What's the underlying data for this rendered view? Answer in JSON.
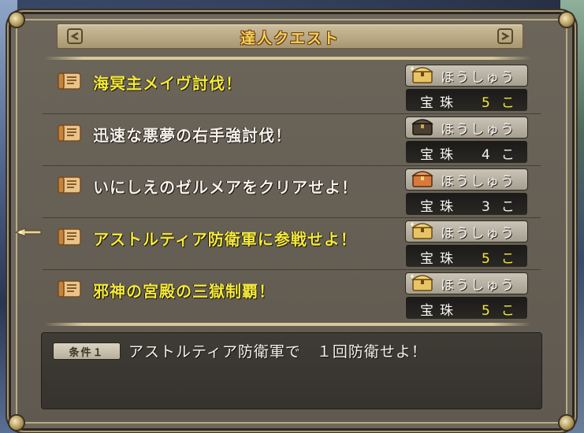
{
  "window": {
    "title": "達人クエスト"
  },
  "quests": [
    {
      "name": "海冥主メイヴ討伐！",
      "highlight": true,
      "reward": {
        "label": "ほうしゅう",
        "item": "宝珠",
        "amount": "5",
        "unit": "こ",
        "chest": "gold-chest-icon",
        "amount_highlight": true
      }
    },
    {
      "name": "迅速な悪夢の右手強討伐！",
      "highlight": false,
      "reward": {
        "label": "ほうしゅう",
        "item": "宝珠",
        "amount": "4",
        "unit": "こ",
        "chest": "dark-chest-icon",
        "amount_highlight": false
      }
    },
    {
      "name": "いにしえのゼルメアをクリアせよ！",
      "highlight": false,
      "reward": {
        "label": "ほうしゅう",
        "item": "宝珠",
        "amount": "3",
        "unit": "こ",
        "chest": "red-chest-icon",
        "amount_highlight": false
      }
    },
    {
      "name": "アストルティア防衛軍に参戦せよ！",
      "highlight": true,
      "reward": {
        "label": "ほうしゅう",
        "item": "宝珠",
        "amount": "5",
        "unit": "こ",
        "chest": "gold-chest-icon",
        "amount_highlight": true
      }
    },
    {
      "name": "邪神の宮殿の三獄制覇！",
      "highlight": true,
      "reward": {
        "label": "ほうしゅう",
        "item": "宝珠",
        "amount": "5",
        "unit": "こ",
        "chest": "gold-chest-icon",
        "amount_highlight": true
      }
    }
  ],
  "condition": {
    "tag": "条件１",
    "text": "アストルティア防衛軍で　１回防衛せよ！"
  },
  "colors": {
    "highlight_text": "#f4ea3a",
    "normal_text": "#f4f1ea",
    "title_text": "#f5d25a",
    "panel_bg": "#6e675c",
    "gold_chest": "#e8c464",
    "dark_chest": "#4a3f30",
    "red_chest": "#d97a3a"
  },
  "selected_quest_index": 3
}
